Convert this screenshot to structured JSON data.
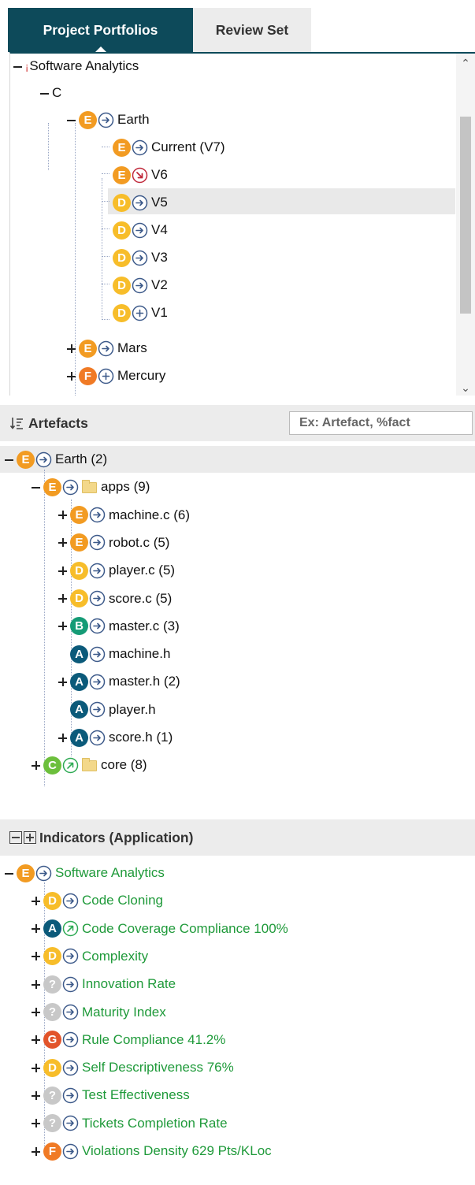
{
  "tabs": [
    {
      "label": "Project Portfolios",
      "active": true
    },
    {
      "label": "Review Set",
      "active": false
    }
  ],
  "portfolio_tree": [
    {
      "label": "Software Analytics"
    },
    {
      "label": "C"
    },
    {
      "label": "Earth",
      "rating": "E",
      "trend": "arrow-right"
    },
    {
      "label": "Current (V7)",
      "rating": "E",
      "trend": "arrow-right",
      "selected": true
    },
    {
      "label": "V6",
      "rating": "E",
      "trend": "arrow-down-right"
    },
    {
      "label": "V5",
      "rating": "D",
      "trend": "arrow-right"
    },
    {
      "label": "V4",
      "rating": "D",
      "trend": "arrow-right"
    },
    {
      "label": "V3",
      "rating": "D",
      "trend": "arrow-right"
    },
    {
      "label": "V2",
      "rating": "D",
      "trend": "arrow-right"
    },
    {
      "label": "V1",
      "rating": "D",
      "trend": "plus"
    },
    {
      "label": "Mars",
      "rating": "E",
      "trend": "arrow-right"
    },
    {
      "label": "Mercury",
      "rating": "F",
      "trend": "plus"
    }
  ],
  "artefacts": {
    "title": "Artefacts",
    "search_placeholder": "Ex: Artefact, %fact",
    "items": [
      {
        "label": "Earth (2)",
        "rating": "E",
        "trend": "arrow-right"
      },
      {
        "label": "apps (9)",
        "rating": "E",
        "trend": "arrow-right",
        "folder": true
      },
      {
        "label": "machine.c (6)",
        "rating": "E",
        "trend": "arrow-right"
      },
      {
        "label": "robot.c (5)",
        "rating": "E",
        "trend": "arrow-right"
      },
      {
        "label": "player.c (5)",
        "rating": "D",
        "trend": "arrow-right"
      },
      {
        "label": "score.c (5)",
        "rating": "D",
        "trend": "arrow-right"
      },
      {
        "label": "master.c (3)",
        "rating": "B",
        "trend": "arrow-right"
      },
      {
        "label": "machine.h",
        "rating": "A",
        "trend": "arrow-right"
      },
      {
        "label": "master.h (2)",
        "rating": "A",
        "trend": "arrow-right"
      },
      {
        "label": "player.h",
        "rating": "A",
        "trend": "arrow-right"
      },
      {
        "label": "score.h (1)",
        "rating": "A",
        "trend": "arrow-right"
      },
      {
        "label": "core (8)",
        "rating": "C",
        "trend": "arrow-up-right",
        "folder": true
      }
    ]
  },
  "indicators": {
    "title": "Indicators (Application)",
    "items": [
      {
        "label": "Software Analytics",
        "rating": "E"
      },
      {
        "label": "Code Cloning",
        "rating": "D"
      },
      {
        "label": "Code Coverage Compliance 100%",
        "rating": "A",
        "trend": "arrow-up-right"
      },
      {
        "label": "Complexity",
        "rating": "D"
      },
      {
        "label": "Innovation Rate",
        "rating": "?"
      },
      {
        "label": "Maturity Index",
        "rating": "?"
      },
      {
        "label": "Rule Compliance 41.2%",
        "rating": "G"
      },
      {
        "label": "Self Descriptiveness 76%",
        "rating": "D"
      },
      {
        "label": "Test Effectiveness",
        "rating": "?"
      },
      {
        "label": "Tickets Completion Rate",
        "rating": "?"
      },
      {
        "label": "Violations Density 629 Pts/KLoc",
        "rating": "F"
      }
    ]
  },
  "colors": {
    "tab_active": "#0d4a5a",
    "A": "#0b5a7a",
    "B": "#159b76",
    "C": "#6cbf3c",
    "D": "#f7bd2a",
    "E": "#f29b22",
    "F": "#f07a25",
    "G": "#e2542a",
    "?": "#c8c8c8",
    "indicator_text": "#1f9a3a",
    "trend_neutral": "#3d5a8a",
    "trend_down": "#c0283a",
    "trend_up": "#2eaa54"
  }
}
